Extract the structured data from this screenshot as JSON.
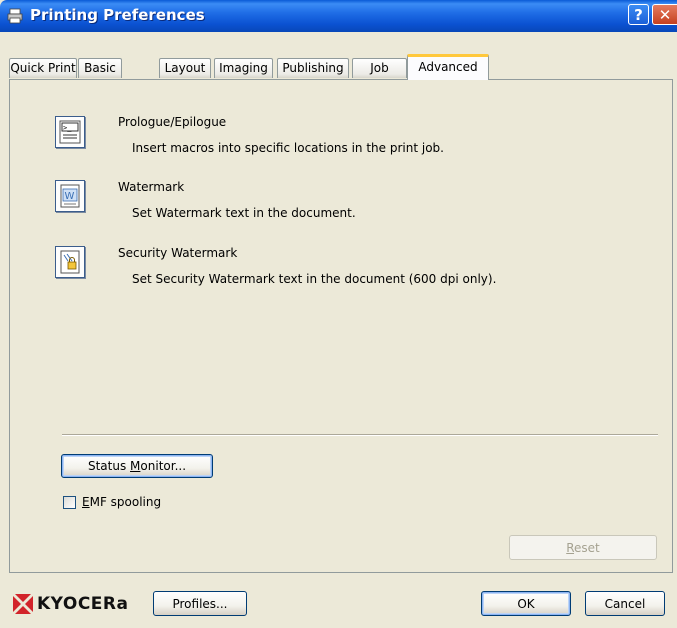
{
  "window": {
    "title": "Printing Preferences",
    "help_glyph": "?",
    "close_glyph": "✕"
  },
  "tabs": [
    {
      "label": "Quick Print",
      "active": false
    },
    {
      "label": "Basic",
      "active": false
    },
    {
      "label": "Layout",
      "active": false
    },
    {
      "label": "Imaging",
      "active": false
    },
    {
      "label": "Publishing",
      "active": false
    },
    {
      "label": "Job",
      "active": false
    },
    {
      "label": "Advanced",
      "active": true
    }
  ],
  "features": [
    {
      "title": "Prologue/Epilogue",
      "description": "Insert macros into specific locations in the print job.",
      "icon": "prologue-epilogue-icon"
    },
    {
      "title": "Watermark",
      "description": "Set Watermark text in the document.",
      "icon": "watermark-icon"
    },
    {
      "title": "Security Watermark",
      "description": "Set Security Watermark text in the document (600 dpi only).",
      "icon": "security-watermark-icon"
    }
  ],
  "status_monitor": {
    "label_before": "Status ",
    "label_accel": "M",
    "label_after": "onitor..."
  },
  "emf_spooling": {
    "label_accel": "E",
    "label_rest": "MF spooling",
    "checked": false
  },
  "reset": {
    "label_accel": "R",
    "label_rest": "eset",
    "enabled": false
  },
  "footer": {
    "brand": "KYOCERa",
    "profiles_label": "Profiles...",
    "ok_label": "OK",
    "cancel_label": "Cancel"
  },
  "colors": {
    "titlebar": "#0b52d2",
    "active_tab_accent": "#ffc83c",
    "brand_red": "#d2232a"
  }
}
